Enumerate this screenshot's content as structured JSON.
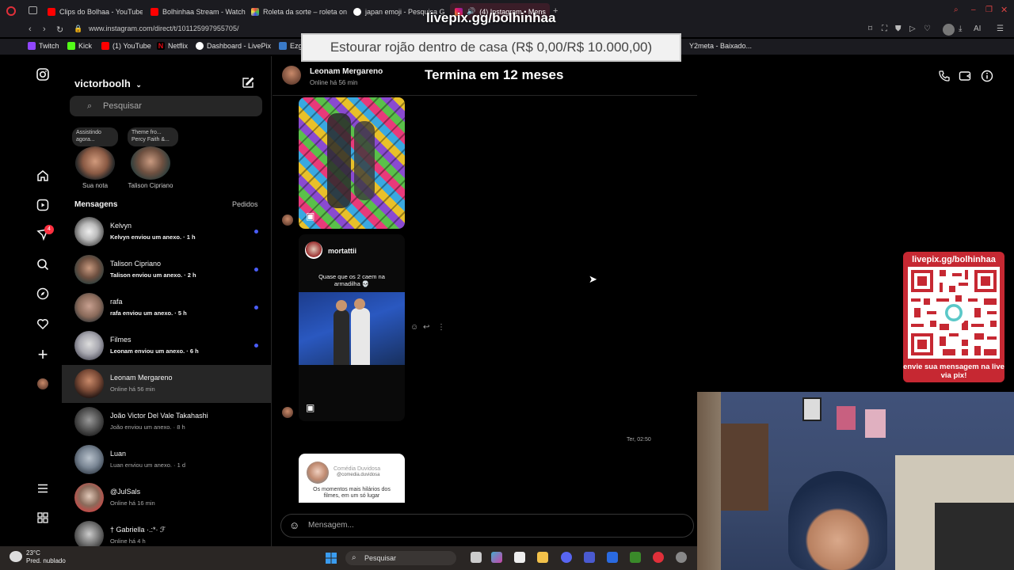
{
  "browser": {
    "tabs": [
      {
        "label": "Clips do Bolhaa - YouTube"
      },
      {
        "label": "Bolhinhaa Stream - Watch"
      },
      {
        "label": "Roleta da sorte – roleta on"
      },
      {
        "label": "japan emoji - Pesquisa G"
      },
      {
        "label": "(4) Instagram • Mens"
      }
    ],
    "url": "www.instagram.com/direct/t/101125997955705/",
    "bookmarks": [
      {
        "label": "Twitch"
      },
      {
        "label": "Kick"
      },
      {
        "label": "(1) YouTube"
      },
      {
        "label": "Netflix"
      },
      {
        "label": "Dashboard - LivePix"
      },
      {
        "label": "Ezgi"
      },
      {
        "label": "Y2meta - Baixado..."
      }
    ],
    "extension_label": "AI"
  },
  "overlay": {
    "livepix_url": "livepix.gg/bolhinhaa",
    "alert_text": "Estourar rojão dentro de casa (R$ 0,00/R$ 10.000,00)",
    "countdown": "Termina em 12 meses",
    "qr_top": "livepix.gg/bolhinhaa",
    "qr_bottom": "envie sua mensagem na live via pix!"
  },
  "instagram": {
    "leftnav": {
      "notification_count": "4"
    },
    "inbox": {
      "username": "victorboolh",
      "search_placeholder": "Pesquisar",
      "notes": [
        {
          "bubble": "Assistindo agora...",
          "caption": "Sua nota"
        },
        {
          "bubble": "Theme fro... Percy Faith &...",
          "caption": "Talison Cipriano"
        }
      ],
      "messages_label": "Mensagens",
      "requests_label": "Pedidos",
      "conversations": [
        {
          "name": "Kelvyn",
          "preview": "Kelvyn enviou um anexo. · 1 h",
          "unread": true
        },
        {
          "name": "Talison Cipriano",
          "preview": "Talison enviou um anexo. · 2 h",
          "unread": true
        },
        {
          "name": "rafa",
          "preview": "rafa enviou um anexo. · 5 h",
          "unread": true
        },
        {
          "name": "Filmes",
          "preview": "Leonam enviou um anexo. · 6 h",
          "unread": true
        },
        {
          "name": "Leonam Mergareno",
          "preview": "Online há 56 min",
          "unread": false
        },
        {
          "name": "João Victor Del Vale Takahashi",
          "preview": "João enviou um anexo. · 8 h",
          "unread": false
        },
        {
          "name": "Luan",
          "preview": "Luan enviou um anexo. · 1 d",
          "unread": false
        },
        {
          "name": "@JulSals",
          "preview": "Online há 16 min",
          "unread": false
        },
        {
          "name": "† Gabriella ·.:*· ℱ",
          "preview": "Online há 4 h",
          "unread": false
        }
      ]
    },
    "thread": {
      "peer_name": "Leonam Mergareno",
      "peer_status": "Online há 56 min",
      "post_author": "mortattii",
      "post_caption": "Quase que os 2 caem na armadilha 💀",
      "timestamp": "Ter, 02:50",
      "preview_name": "Comédia Duvidosa",
      "preview_handle": "@comedia.duvidosa",
      "preview_text": "Os momentos mais hilários dos filmes, em um só lugar",
      "input_placeholder": "Mensagem..."
    }
  },
  "taskbar": {
    "temperature": "23°C",
    "weather": "Pred. nublado",
    "search_label": "Pesquisar"
  }
}
